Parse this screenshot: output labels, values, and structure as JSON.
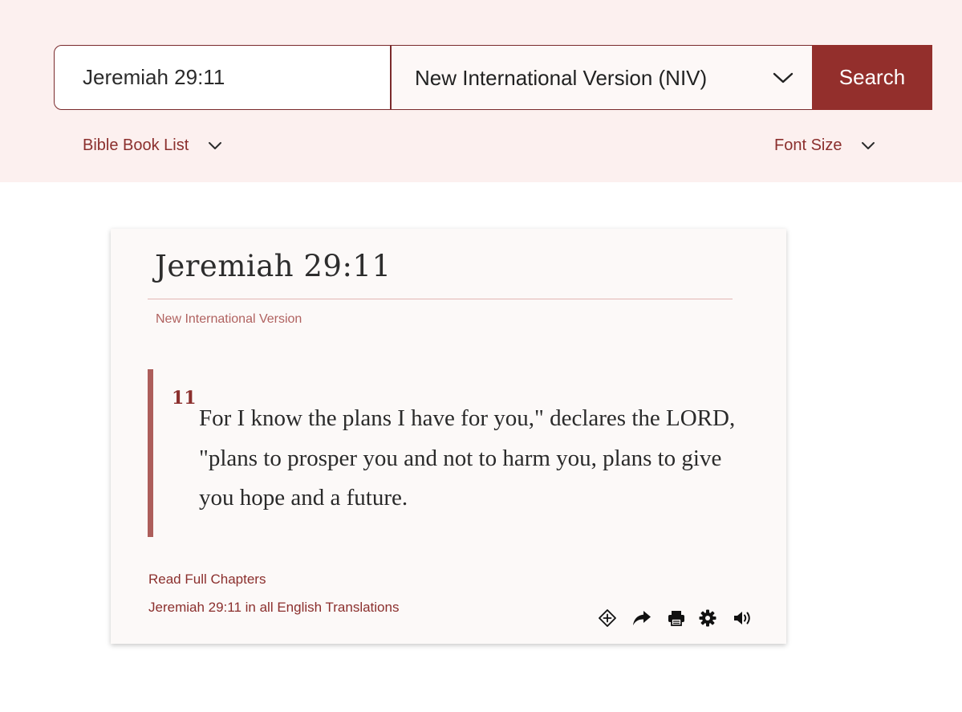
{
  "search": {
    "query": "Jeremiah 29:11",
    "version_selected": "New International Version (NIV)",
    "button_label": "Search"
  },
  "options": {
    "book_list_label": "Bible Book List",
    "font_size_label": "Font Size"
  },
  "passage": {
    "title": "Jeremiah 29:11",
    "version": "New International Version",
    "verse_number": "11",
    "verse_text": "For I know the plans I have for you,\" declares the LORD, \"plans to prosper you and not to harm you, plans to give you hope and a future."
  },
  "links": {
    "read_full": "Read Full Chapters",
    "all_translations": "Jeremiah 29:11 in all English Translations"
  },
  "tools": [
    "add-plus-icon",
    "share-icon",
    "print-icon",
    "settings-gear-icon",
    "speaker-audio-icon"
  ],
  "colors": {
    "accent": "#932f2c",
    "link": "#8b2f2d",
    "band": "#fcf0ef",
    "card": "#fcf9f8",
    "verse_bar": "#ad5e5b"
  }
}
